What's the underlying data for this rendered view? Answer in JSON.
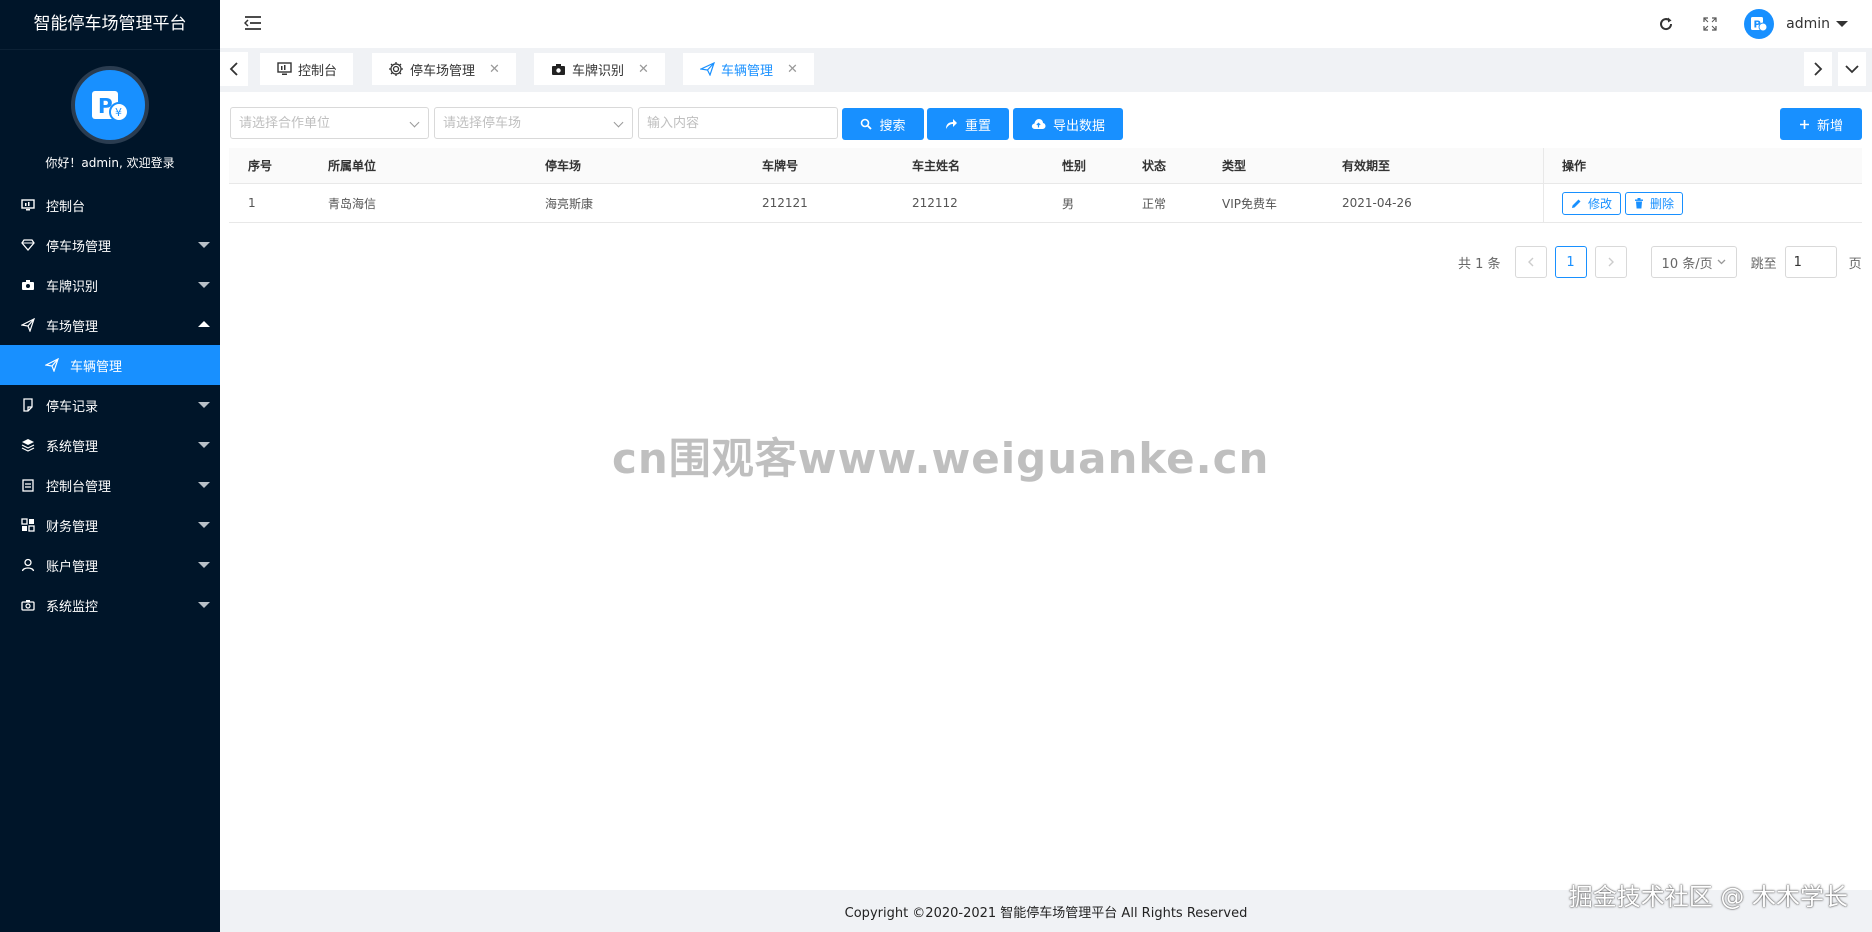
{
  "app": {
    "title": "智能停车场管理平台"
  },
  "profile": {
    "welcome": "你好！admin, 欢迎登录"
  },
  "sidebar": {
    "items": [
      {
        "label": "控制台",
        "icon": "monitor-icon"
      },
      {
        "label": "停车场管理",
        "icon": "diamond-icon"
      },
      {
        "label": "车牌识别",
        "icon": "camera-icon"
      },
      {
        "label": "车场管理",
        "icon": "send-icon",
        "expanded": true
      },
      {
        "label": "车辆管理",
        "icon": "send-icon",
        "active": true
      },
      {
        "label": "停车记录",
        "icon": "note-icon"
      },
      {
        "label": "系统管理",
        "icon": "layers-icon"
      },
      {
        "label": "控制台管理",
        "icon": "clipboard-icon"
      },
      {
        "label": "财务管理",
        "icon": "grid-icon"
      },
      {
        "label": "账户管理",
        "icon": "user-icon"
      },
      {
        "label": "系统监控",
        "icon": "camera-icon"
      }
    ]
  },
  "header": {
    "user": "admin"
  },
  "tabs": [
    {
      "label": "控制台",
      "icon": "monitor-icon"
    },
    {
      "label": "停车场管理",
      "icon": "gear-icon"
    },
    {
      "label": "车牌识别",
      "icon": "camera-icon"
    },
    {
      "label": "车辆管理",
      "icon": "send-icon",
      "active": true
    }
  ],
  "toolbar": {
    "partner_placeholder": "请选择合作单位",
    "lot_placeholder": "请选择停车场",
    "keyword_placeholder": "输入内容",
    "search_label": "搜索",
    "reset_label": "重置",
    "export_label": "导出数据",
    "add_label": "新增"
  },
  "table": {
    "columns": [
      "序号",
      "所属单位",
      "停车场",
      "车牌号",
      "车主姓名",
      "性别",
      "状态",
      "类型",
      "有效期至",
      "操作"
    ],
    "rows": [
      {
        "index": "1",
        "unit": "青岛海信",
        "lot": "海亮斯康",
        "plate": "212121",
        "owner": "212112",
        "gender": "男",
        "status": "正常",
        "type": "VIP免费车",
        "expiry": "2021-04-26"
      }
    ],
    "edit_label": "修改",
    "delete_label": "删除"
  },
  "pagination": {
    "total": "共 1 条",
    "current_page": "1",
    "page_size": "10 条/页",
    "goto_label": "跳至",
    "goto_value": "1",
    "page_suffix": "页"
  },
  "watermark": "cn围观客www.weiguanke.cn",
  "footer": {
    "copyright": "Copyright ©2020-2021 智能停车场管理平台 All Rights Reserved",
    "community": "掘金技术社区 @ 木木学长"
  },
  "colors": {
    "sidebar": "#001529",
    "accent": "#1890ff"
  }
}
